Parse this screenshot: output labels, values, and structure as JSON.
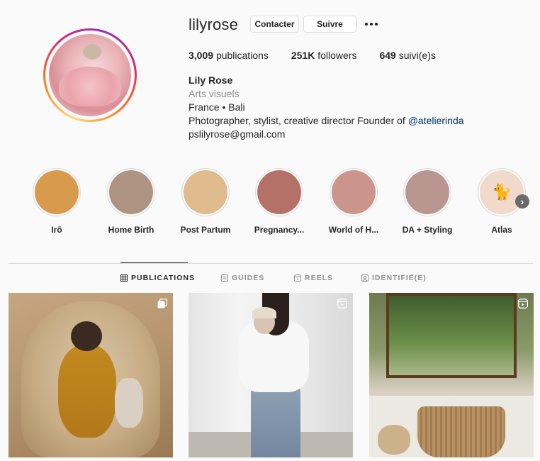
{
  "profile": {
    "username": "lilyrose",
    "contact_label": "Contacter",
    "follow_label": "Suivre",
    "stats": {
      "posts_count": "3,009",
      "posts_label": "publications",
      "followers_count": "251K",
      "followers_label": "followers",
      "following_count": "649",
      "following_label": "suivi(e)s"
    },
    "full_name": "Lily Rose",
    "category": "Arts visuels",
    "bio_line1": "France • Bali",
    "bio_line2_text": "Photographer, stylist, creative director Founder of ",
    "bio_line2_mention": "@atelierinda",
    "bio_line3": "pslilyrose@gmail.com"
  },
  "highlights": [
    {
      "label": "Irō",
      "color": "#d89a4c"
    },
    {
      "label": "Home Birth",
      "color": "#ae9482"
    },
    {
      "label": "Post Partum",
      "color": "#e0bb8e"
    },
    {
      "label": "Pregnancy...",
      "color": "#b37167"
    },
    {
      "label": "World of H...",
      "color": "#cc958c"
    },
    {
      "label": "DA + Styling",
      "color": "#b99790"
    },
    {
      "label": "Atlas",
      "color": "#f1d9cb",
      "icon": "cat-icon"
    }
  ],
  "tabs": [
    {
      "label": "PUBLICATIONS",
      "icon": "grid-icon",
      "active": true
    },
    {
      "label": "GUIDES",
      "icon": "guides-icon",
      "active": false
    },
    {
      "label": "REELS",
      "icon": "reels-icon",
      "active": false
    },
    {
      "label": "IDENTIFIÉ(E)",
      "icon": "tagged-icon",
      "active": false
    }
  ],
  "posts": [
    {
      "badge": "carousel-icon"
    },
    {
      "badge": "reel-icon"
    },
    {
      "badge": "reel-icon"
    }
  ]
}
